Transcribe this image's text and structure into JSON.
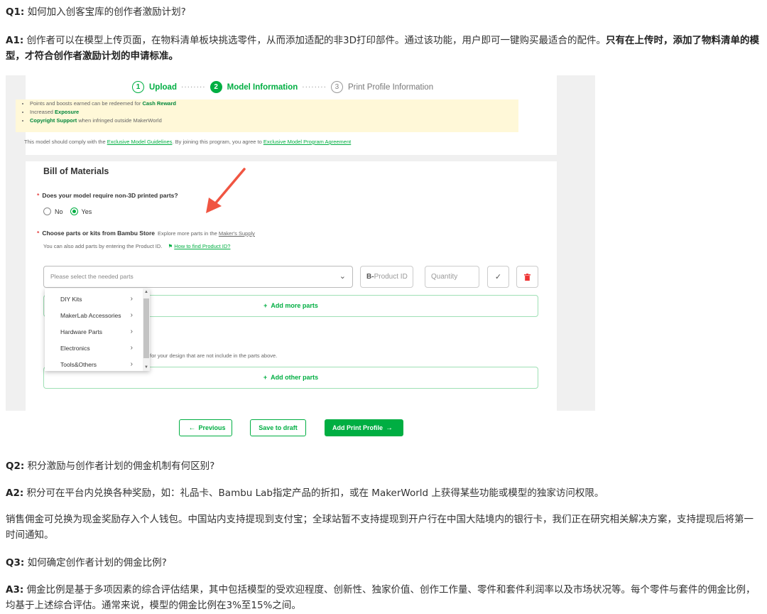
{
  "faq": {
    "q1": {
      "label": "Q1:",
      "text": " 如何加入创客宝库的创作者激励计划?"
    },
    "a1": {
      "label": "A1:",
      "text": " 创作者可以在模型上传页面，在物料清单板块挑选零件，从而添加适配的非3D打印部件。通过该功能，用户即可一键购买最适合的配件。",
      "bold": "只有在上传时，添加了物料清单的模型，才符合创作者激励计划的申请标准。"
    },
    "q2": {
      "label": "Q2:",
      "text": " 积分激励与创作者计划的佣金机制有何区别?"
    },
    "a2": {
      "label": "A2:",
      "text": " 积分可在平台内兑换各种奖励，如：礼品卡、Bambu Lab指定产品的折扣，或在 MakerWorld 上获得某些功能或模型的独家访问权限。"
    },
    "p2": "销售佣金可兑换为现金奖励存入个人钱包。中国站内支持提现到支付宝；全球站暂不支持提现到开户行在中国大陆境内的银行卡，我们正在研究相关解决方案，支持提现后将第一时间通知。",
    "q3": {
      "label": "Q3:",
      "text": " 如何确定创作者计划的佣金比例?"
    },
    "a3": {
      "label": "A3:",
      "text": " 佣金比例是基于多项因素的综合评估结果，其中包括模型的受欢迎程度、创新性、独家价值、创作工作量、零件和套件利润率以及市场状况等。每个零件与套件的佣金比例，均基于上述综合评估。通常来说，模型的佣金比例在3%至15%之间。"
    }
  },
  "screenshot": {
    "steps": [
      {
        "num": "1",
        "label": "Upload"
      },
      {
        "num": "2",
        "label": "Model Information"
      },
      {
        "num": "3",
        "label": "Print Profile Information"
      }
    ],
    "step_dots": "········",
    "benefits": [
      {
        "pre": "Points and boosts earned can be redeemed for ",
        "bold": "Cash Reward",
        "post": ""
      },
      {
        "pre": "Increased ",
        "bold": "Exposure",
        "post": ""
      },
      {
        "pre": "",
        "bold": "Copyright Support",
        "post": " when infringed outside MakerWorld"
      }
    ],
    "comply": {
      "pre": "This model should comply with the ",
      "link1": "Exclusive Model Guidelines",
      "mid": ". By joining this program, you agree to ",
      "link2": "Exclusive Model Program Agreement"
    },
    "bom_title": "Bill of Materials",
    "question1": "Does your model require non-3D printed parts?",
    "radio_no": "No",
    "radio_yes": "Yes",
    "question2": "Choose parts or kits from Bambu Store",
    "question2_sub": "Explore more parts in the ",
    "makers_supply": "Maker's Supply",
    "hint": "You can also add parts by entering the Product ID.",
    "hint_link": "How to find Product ID?",
    "select_placeholder": "Please select the needed parts",
    "product_id_prefix": "B-",
    "product_id": "Product ID",
    "quantity": "Quantity",
    "add_more_parts": "Add more parts",
    "other_desc": "for your design that are not include in the parts above.",
    "add_other_parts": "Add other parts",
    "dropdown": [
      "DIY Kits",
      "MakerLab Accessories",
      "Hardware Parts",
      "Electronics",
      "Tools&Others"
    ],
    "btn_previous": "Previous",
    "btn_draft": "Save to draft",
    "btn_add_print": "Add Print Profile"
  },
  "colors": {
    "accent": "#00ae42",
    "required": "#e54444",
    "arrow": "#f05542",
    "benefits_bg": "#fff8d8"
  }
}
